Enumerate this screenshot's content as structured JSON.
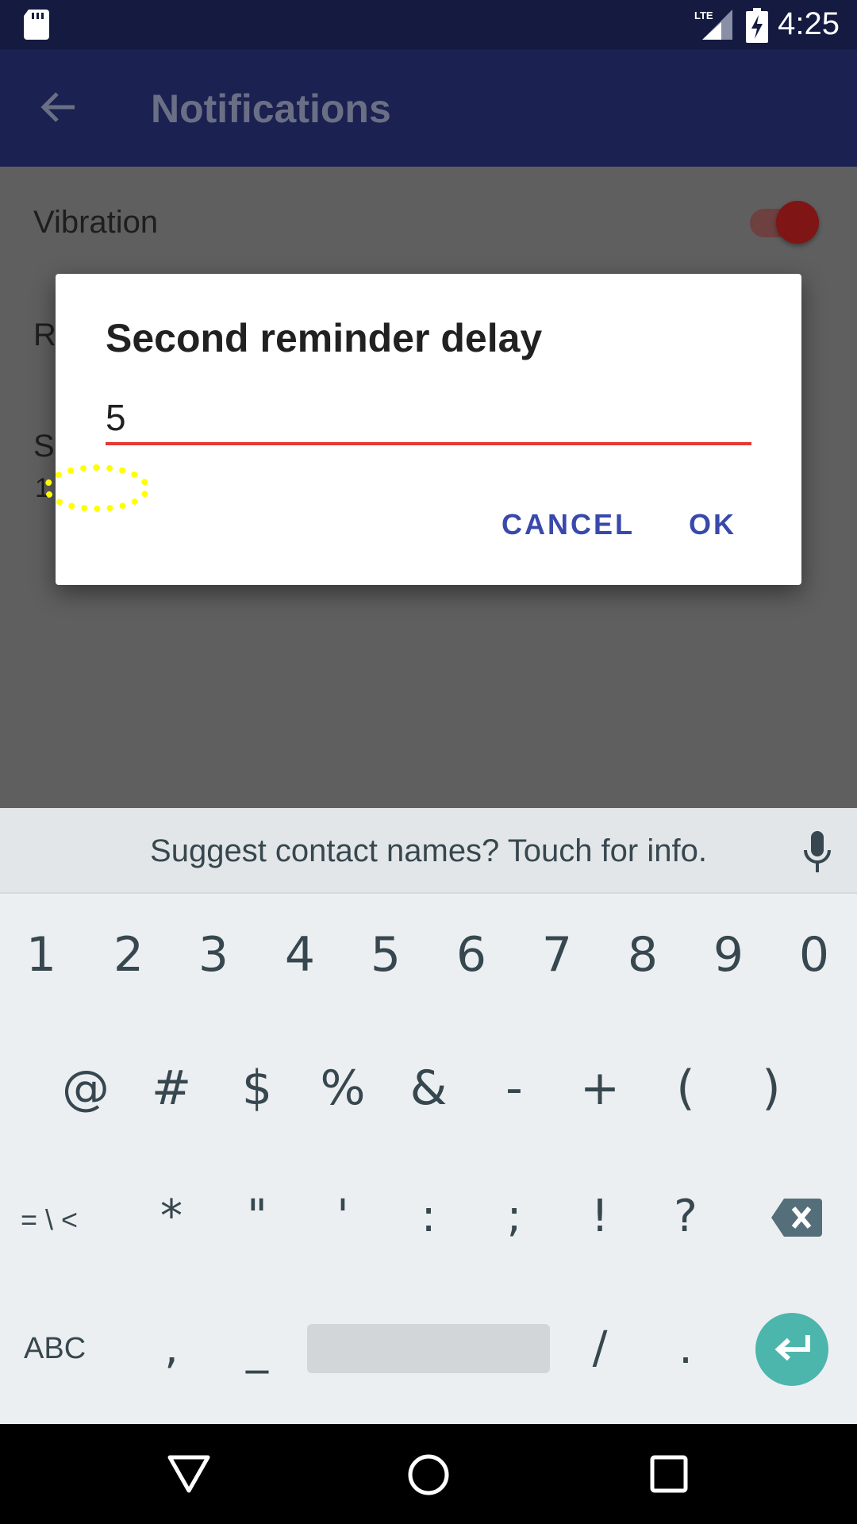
{
  "status_bar": {
    "time": "4:25",
    "network": "LTE",
    "icons": [
      "sd-card-icon",
      "lte-signal-icon",
      "battery-charging-icon"
    ]
  },
  "app_bar": {
    "title": "Notifications",
    "back_icon": "arrow-left-icon"
  },
  "settings": {
    "vibration_label": "Vibration",
    "vibration_enabled": true,
    "item2_partial": "R",
    "item3_partial": "S",
    "item3_sub_partial": "1"
  },
  "dialog": {
    "title": "Second reminder delay",
    "input_value": "5",
    "cancel_label": "CANCEL",
    "ok_label": "OK"
  },
  "keyboard": {
    "suggestion": "Suggest contact names? Touch for info.",
    "row1": [
      "1",
      "2",
      "3",
      "4",
      "5",
      "6",
      "7",
      "8",
      "9",
      "0"
    ],
    "row2": [
      "@",
      "#",
      "$",
      "%",
      "&",
      "-",
      "+",
      "(",
      ")"
    ],
    "row3_mode": "= \\ <",
    "row3": [
      "*",
      "\"",
      "'",
      ":",
      ";",
      "!",
      "?"
    ],
    "row4_mode": "ABC",
    "row4_left": [
      ",",
      "_"
    ],
    "row4_right": [
      "/",
      "."
    ]
  },
  "colors": {
    "status_bar": "#141a40",
    "app_bar": "#1b2150",
    "accent_red": "#e53935",
    "dialog_button": "#3949ab",
    "enter_key": "#4db6ac"
  }
}
